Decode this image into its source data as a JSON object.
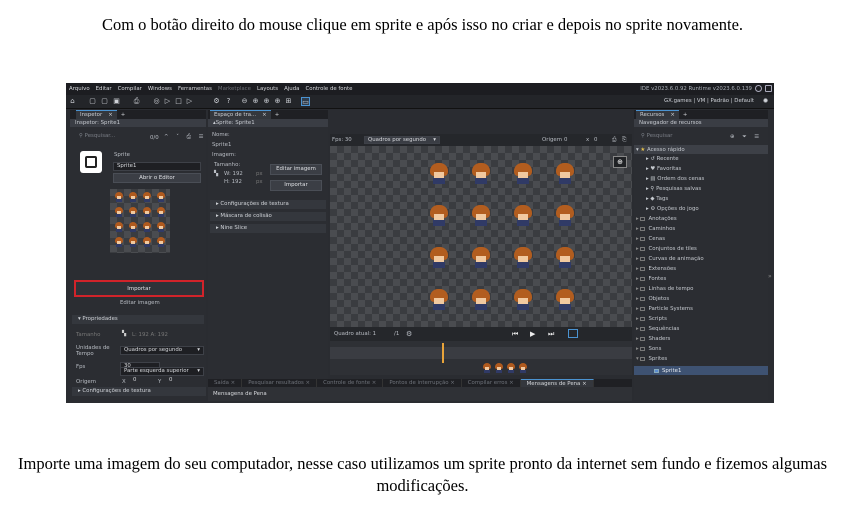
{
  "captions": {
    "top": "Com o botão direito do mouse clique em sprite e após isso no criar e depois no sprite novamente.",
    "bottom": "Importe uma imagem do seu computador, nesse caso utilizamos um sprite pronto da internet sem fundo e fizemos algumas modificações."
  },
  "menu": [
    "Arquivo",
    "Editar",
    "Compilar",
    "Windows",
    "Ferramentas",
    "Marketplace",
    "Layouts",
    "Ajuda",
    "Controle de fonte"
  ],
  "ide_version": "IDE v2023.6.0.92  Runtime v2023.6.0.139",
  "target": "GX.games | VM | Padrão | Default",
  "inspector": {
    "tab": "Inspetor",
    "subtitle": "Inspetor: Sprite1",
    "search": "Pesquisar...",
    "count": "0/0",
    "sprite_label": "Sprite",
    "sprite_name": "Sprite1",
    "open_editor": "Abrir o Editor",
    "import": "Importar",
    "edit_image": "Editar imagem",
    "properties": "Propriedades",
    "size_label": "Tamanho",
    "size_value": "L: 192  A: 192",
    "units_label": "Unidades de Tempo",
    "units_value": "Quadros por segundo",
    "fps_label": "Fps",
    "fps_value": "30",
    "origin_label": "Origem",
    "ox_label": "X",
    "ox": "0",
    "oy_label": "Y",
    "oy": "0",
    "origin_preset": "Parte esquerda superior",
    "texture_cfg": "Configurações de textura"
  },
  "workspace": {
    "tab": "Espaço de tra...",
    "sub": "Sprite: Sprite1",
    "name_label": "Nome:",
    "name": "Sprite1",
    "image_label": "Imagem:",
    "size_label": "Tamanho:",
    "w": "W: 192",
    "h": "H: 192",
    "px": "px",
    "edit_image": "Editar imagem",
    "import": "Importar",
    "sections": [
      "Configurações de textura",
      "Máscara de colisão",
      "Nine Slice"
    ]
  },
  "canvas": {
    "fps_label": "Fps: 30",
    "mode": "Quadros por segundo",
    "origin_label": "Origem",
    "ox": "0",
    "x_label": "x",
    "oy": "0",
    "frame_label": "Quadro atual: 1",
    "frame_total": "/1"
  },
  "resources": {
    "tab": "Recursos",
    "sub": "Navegador de recursos",
    "search": "Pesquisar",
    "quick": "Acesso rápido",
    "quick_items": [
      "Recente",
      "Favoritas",
      "Ordem dos cenas",
      "Pesquisas salvas",
      "Tags",
      "Opções do jogo"
    ],
    "groups": [
      "Anotações",
      "Caminhos",
      "Cenas",
      "Conjuntos de tiles",
      "Curvas de animação",
      "Extensões",
      "Fontes",
      "Linhas de tempo",
      "Objetos",
      "Particle Systems",
      "Scripts",
      "Sequências",
      "Shaders",
      "Sons",
      "Sprites"
    ],
    "selected": "Sprite1"
  },
  "bottom_tabs": [
    "Saída",
    "Pesquisar resultados",
    "Controle de fonte",
    "Pontos de interrupção",
    "Compilar erros",
    "Mensagens de Pena"
  ],
  "bottom_status": "Mensagens de Pena",
  "colors": {
    "accent": "#4b93d1",
    "highlight": "#d1232a",
    "bg": "#2a2c31"
  }
}
